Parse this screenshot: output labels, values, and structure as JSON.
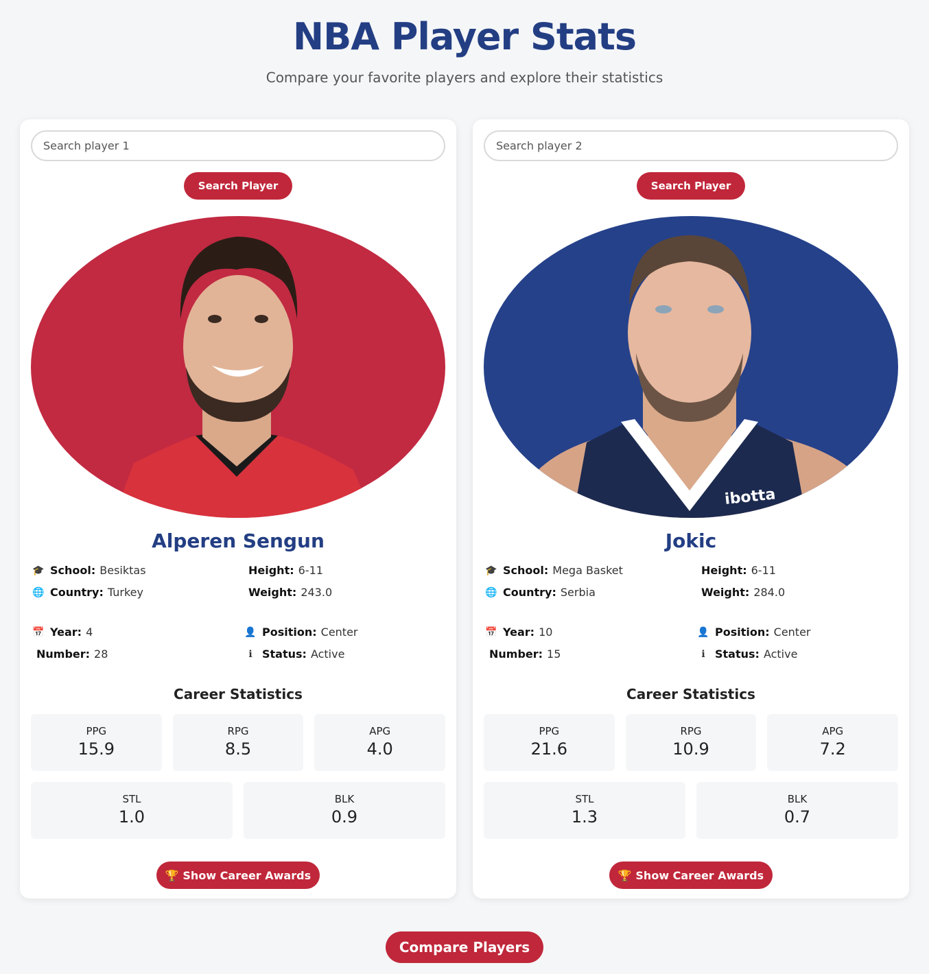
{
  "header": {
    "title": "NBA Player Stats",
    "subtitle": "Compare your favorite players and explore their statistics"
  },
  "colors": {
    "accent": "#c0273a",
    "brand": "#233e83",
    "player1_bg": "#c22a42",
    "player2_bg": "#25418a"
  },
  "players": [
    {
      "search_placeholder": "Search player 1",
      "search_button": "Search Player",
      "name": "Alperen Sengun",
      "info": {
        "school_label": "School:",
        "school": "Besiktas",
        "height_label": "Height:",
        "height": "6-11",
        "country_label": "Country:",
        "country": "Turkey",
        "weight_label": "Weight:",
        "weight": "243.0",
        "year_label": "Year:",
        "year": "4",
        "position_label": "Position:",
        "position": "Center",
        "number_label": "Number:",
        "number": "28",
        "status_label": "Status:",
        "status": "Active"
      },
      "stats_title": "Career Statistics",
      "stats": {
        "ppg_label": "PPG",
        "ppg": "15.9",
        "rpg_label": "RPG",
        "rpg": "8.5",
        "apg_label": "APG",
        "apg": "4.0",
        "stl_label": "STL",
        "stl": "1.0",
        "blk_label": "BLK",
        "blk": "0.9"
      },
      "awards_button": "Show Career Awards"
    },
    {
      "search_placeholder": "Search player 2",
      "search_button": "Search Player",
      "name": "Jokic",
      "info": {
        "school_label": "School:",
        "school": "Mega Basket",
        "height_label": "Height:",
        "height": "6-11",
        "country_label": "Country:",
        "country": "Serbia",
        "weight_label": "Weight:",
        "weight": "284.0",
        "year_label": "Year:",
        "year": "10",
        "position_label": "Position:",
        "position": "Center",
        "number_label": "Number:",
        "number": "15",
        "status_label": "Status:",
        "status": "Active"
      },
      "stats_title": "Career Statistics",
      "stats": {
        "ppg_label": "PPG",
        "ppg": "21.6",
        "rpg_label": "RPG",
        "rpg": "10.9",
        "apg_label": "APG",
        "apg": "7.2",
        "stl_label": "STL",
        "stl": "1.3",
        "blk_label": "BLK",
        "blk": "0.7"
      },
      "jersey_text": "ibotta",
      "awards_button": "Show Career Awards"
    }
  ],
  "compare_button": "Compare Players"
}
